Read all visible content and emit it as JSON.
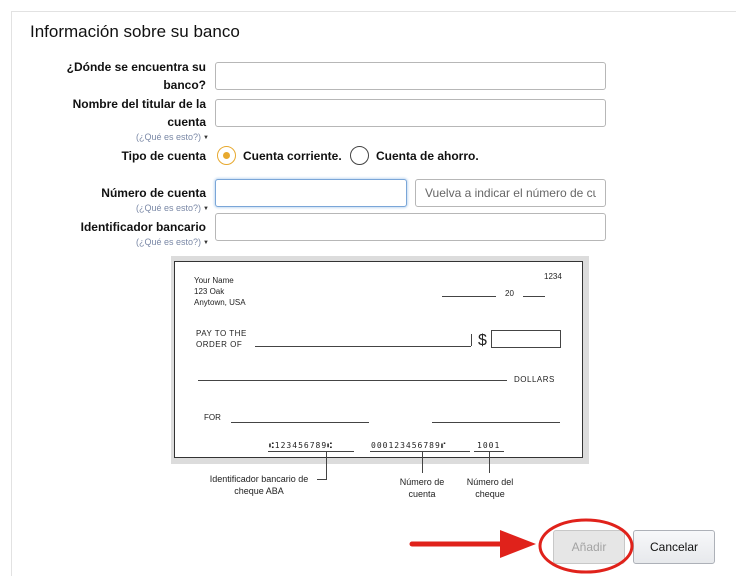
{
  "section": {
    "title": "Información sobre su banco"
  },
  "form": {
    "bank_location": {
      "label": "¿Dónde se encuentra su banco?",
      "value": ""
    },
    "account_holder": {
      "label": "Nombre del titular de la cuenta",
      "help": "(¿Qué es esto?)",
      "value": ""
    },
    "account_type": {
      "label": "Tipo de cuenta",
      "options": [
        {
          "label": "Cuenta corriente.",
          "selected": true
        },
        {
          "label": "Cuenta de ahorro.",
          "selected": false
        }
      ]
    },
    "account_number": {
      "label": "Número de cuenta",
      "help": "(¿Qué es esto?)",
      "value": "",
      "confirm_placeholder": "Vuelva a indicar el número de cu"
    },
    "bank_id": {
      "label": "Identificador bancario",
      "help": "(¿Qué es esto?)",
      "value": ""
    }
  },
  "check_example": {
    "name": "Your Name",
    "address1": "123 Oak",
    "address2": "Anytown, USA",
    "check_number": "1234",
    "date_year": "20",
    "pay_to_line1": "PAY TO THE",
    "pay_to_line2": "ORDER OF",
    "currency_symbol": "$",
    "dollars": "DOLLARS",
    "for": "FOR",
    "micr_routing": "⑆123456789⑆",
    "micr_account": "000123456789⑈",
    "micr_check": "1001",
    "caption_routing": "Identificador bancario de cheque ABA",
    "caption_account": "Número de cuenta",
    "caption_check": "Número del cheque"
  },
  "actions": {
    "add_label": "Añadir",
    "add_enabled": false,
    "cancel_label": "Cancelar"
  },
  "colors": {
    "radio_selected": "#e7a92f",
    "annotation_red": "#e0221b",
    "help_link": "#7a88a6"
  }
}
